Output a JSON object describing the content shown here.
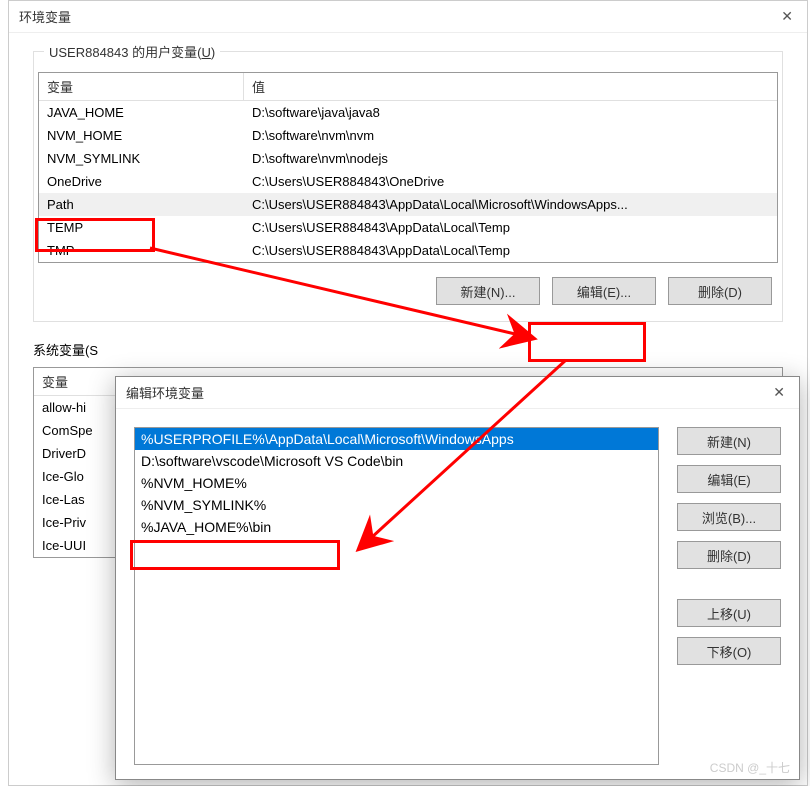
{
  "main": {
    "title": "环境变量",
    "user_group_title_prefix": "USER884843 的用户变量(",
    "user_group_key": "U",
    "user_group_suffix": ")",
    "columns": {
      "var": "变量",
      "val": "值"
    },
    "user_vars": [
      {
        "name": "JAVA_HOME",
        "value": "D:\\software\\java\\java8"
      },
      {
        "name": "NVM_HOME",
        "value": "D:\\software\\nvm\\nvm"
      },
      {
        "name": "NVM_SYMLINK",
        "value": "D:\\software\\nvm\\nodejs"
      },
      {
        "name": "OneDrive",
        "value": "C:\\Users\\USER884843\\OneDrive"
      },
      {
        "name": "Path",
        "value": "C:\\Users\\USER884843\\AppData\\Local\\Microsoft\\WindowsApps..."
      },
      {
        "name": "TEMP",
        "value": "C:\\Users\\USER884843\\AppData\\Local\\Temp"
      },
      {
        "name": "TMP",
        "value": "C:\\Users\\USER884843\\AppData\\Local\\Temp"
      }
    ],
    "buttons": {
      "new": "新建(N)...",
      "edit": "编辑(E)...",
      "delete": "删除(D)"
    },
    "sys_group_title": "系统变量(S",
    "sys_vars": [
      {
        "name": "allow-hi"
      },
      {
        "name": "ComSpe"
      },
      {
        "name": "DriverD"
      },
      {
        "name": "Ice-Glo"
      },
      {
        "name": "Ice-Las"
      },
      {
        "name": "Ice-Priv"
      },
      {
        "name": "Ice-UUI"
      }
    ]
  },
  "edit": {
    "title": "编辑环境变量",
    "paths": [
      "%USERPROFILE%\\AppData\\Local\\Microsoft\\WindowsApps",
      "D:\\software\\vscode\\Microsoft VS Code\\bin",
      "%NVM_HOME%",
      "%NVM_SYMLINK%",
      "%JAVA_HOME%\\bin"
    ],
    "buttons": {
      "new": "新建(N)",
      "edit": "编辑(E)",
      "browse": "浏览(B)...",
      "delete": "删除(D)",
      "up": "上移(U)",
      "down": "下移(O)"
    }
  },
  "watermark": "CSDN @_十七"
}
